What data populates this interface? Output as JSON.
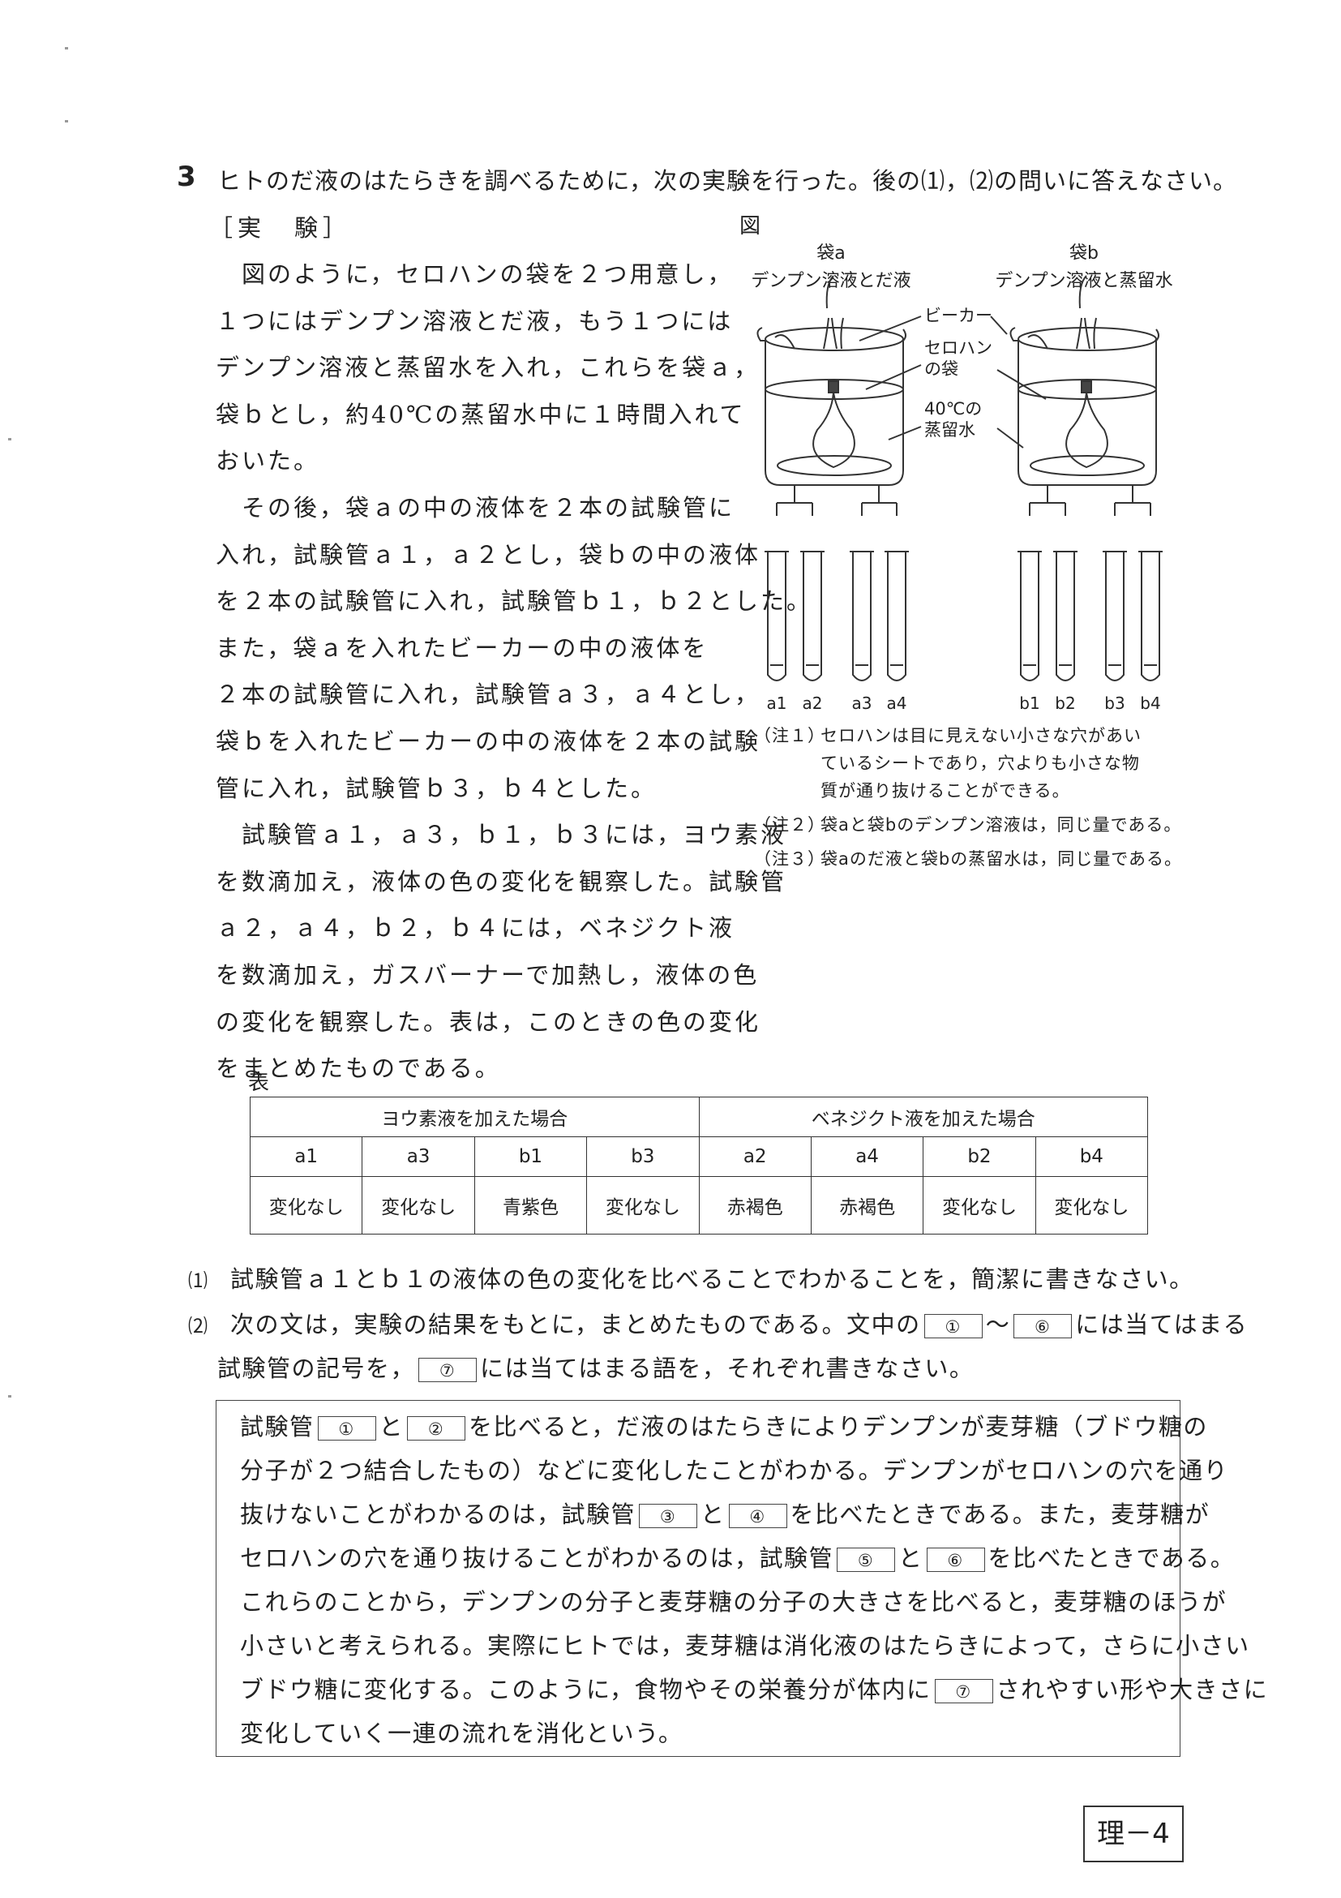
{
  "question": {
    "number": "3",
    "intro": "ヒトのだ液のはたらきを調べるために，次の実験を行った。後の⑴，⑵の問いに答えなさい。",
    "experiment_heading": "［実　験］",
    "experiment_lines": [
      "　図のように，セロハンの袋を２つ用意し，",
      "１つにはデンプン溶液とだ液，もう１つには",
      "デンプン溶液と蒸留水を入れ，これらを袋ａ，",
      "袋ｂとし，約40℃の蒸留水中に１時間入れて",
      "おいた。",
      "　その後，袋ａの中の液体を２本の試験管に",
      "入れ，試験管ａ１，ａ２とし，袋ｂの中の液体",
      "を２本の試験管に入れ，試験管ｂ１，ｂ２とした。",
      "また，袋ａを入れたビーカーの中の液体を",
      "２本の試験管に入れ，試験管ａ３，ａ４とし，",
      "袋ｂを入れたビーカーの中の液体を２本の試験",
      "管に入れ，試験管ｂ３，ｂ４とした。",
      "　試験管ａ１，ａ３，ｂ１，ｂ３には，ヨウ素液",
      "を数滴加え，液体の色の変化を観察した。試験管",
      "ａ２，ａ４，ｂ２，ｂ４には，ベネジクト液",
      "を数滴加え，ガスバーナーで加熱し，液体の色",
      "の変化を観察した。表は，このときの色の変化",
      "をまとめたものである。"
    ]
  },
  "figure": {
    "label": "図",
    "bag_a_title": "袋a",
    "bag_a_contents": "デンプン溶液とだ液",
    "bag_b_title": "袋b",
    "bag_b_contents": "デンプン溶液と蒸留水",
    "beaker_label": "ビーカー",
    "cellophane_label_1": "セロハン",
    "cellophane_label_2": "の袋",
    "water_label_1": "40℃の",
    "water_label_2": "蒸留水",
    "tube_labels": [
      "a1",
      "a2",
      "a3",
      "a4",
      "b1",
      "b2",
      "b3",
      "b4"
    ]
  },
  "notes": [
    {
      "tag": "（注１）",
      "lines": [
        "セロハンは目に見えない小さな穴があい",
        "ているシートであり，穴よりも小さな物",
        "質が通り抜けることができる。"
      ]
    },
    {
      "tag": "（注２）",
      "lines": [
        "袋aと袋bのデンプン溶液は，同じ量である。"
      ]
    },
    {
      "tag": "（注３）",
      "lines": [
        "袋aのだ液と袋bの蒸留水は，同じ量である。"
      ]
    }
  ],
  "table": {
    "label": "表",
    "group_iodine": "ヨウ素液を加えた場合",
    "group_benedict": "ベネジクト液を加えた場合",
    "headers": [
      "a1",
      "a3",
      "b1",
      "b3",
      "a2",
      "a4",
      "b2",
      "b4"
    ],
    "values": [
      "変化なし",
      "変化なし",
      "青紫色",
      "変化なし",
      "赤褐色",
      "赤褐色",
      "変化なし",
      "変化なし"
    ]
  },
  "subquestions": {
    "q1_no": "⑴",
    "q1_text": "試験管ａ１とｂ１の液体の色の変化を比べることでわかることを，簡潔に書きなさい。",
    "q2_no": "⑵",
    "q2_a": "次の文は，実験の結果をもとに，まとめたものである。文中の",
    "q2_tilde": "～",
    "q2_b": "には当てはまる",
    "q2_c": "試験管の記号を，",
    "q2_d": "には当てはまる語を，それぞれ書きなさい。"
  },
  "blanks": [
    "①",
    "②",
    "③",
    "④",
    "⑤",
    "⑥",
    "⑦"
  ],
  "answer": {
    "l1a": "試験管",
    "l1b": "と",
    "l1c": "を比べると，だ液のはたらきによりデンプンが麦芽糖（ブドウ糖の",
    "l2": "分子が２つ結合したもの）などに変化したことがわかる。デンプンがセロハンの穴を通り",
    "l3a": "抜けないことがわかるのは，試験管",
    "l3b": "と",
    "l3c": "を比べたときである。また，麦芽糖が",
    "l4a": "セロハンの穴を通り抜けることがわかるのは，試験管",
    "l4b": "と",
    "l4c": "を比べたときである。",
    "l5": "これらのことから，デンプンの分子と麦芽糖の分子の大きさを比べると，麦芽糖のほうが",
    "l6": "小さいと考えられる。実際にヒトでは，麦芽糖は消化液のはたらきによって，さらに小さい",
    "l7a": "ブドウ糖に変化する。このように，食物やその栄養分が体内に",
    "l7b": "されやすい形や大きさに",
    "l8": "変化していく一連の流れを消化という。"
  },
  "page_number": "理－4"
}
